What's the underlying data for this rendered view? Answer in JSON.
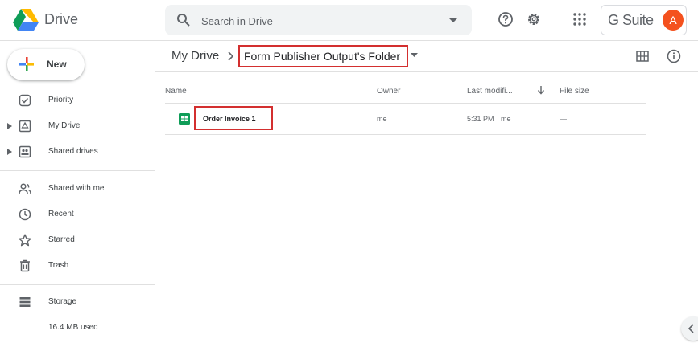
{
  "header": {
    "app_name": "Drive",
    "search_placeholder": "Search in Drive",
    "gsuite_label": "G Suite",
    "avatar_initial": "A",
    "colors": {
      "avatar": "#f4511e",
      "search_bg": "#f1f3f4"
    }
  },
  "sidebar": {
    "new_label": "New",
    "items": [
      {
        "label": "Priority",
        "icon": "priority-icon"
      },
      {
        "label": "My Drive",
        "icon": "my-drive-icon"
      },
      {
        "label": "Shared drives",
        "icon": "shared-drives-icon"
      },
      {
        "label": "Shared with me",
        "icon": "shared-with-me-icon"
      },
      {
        "label": "Recent",
        "icon": "clock-icon"
      },
      {
        "label": "Starred",
        "icon": "star-icon"
      },
      {
        "label": "Trash",
        "icon": "trash-icon"
      },
      {
        "label": "Storage",
        "icon": "storage-icon"
      }
    ],
    "storage_used": "16.4 MB used"
  },
  "breadcrumb": {
    "root": "My Drive",
    "current": "Form Publisher Output's Folder"
  },
  "table": {
    "columns": [
      "Name",
      "Owner",
      "Last modifi...",
      "File size"
    ],
    "rows": [
      {
        "name": "Order Invoice 1",
        "owner": "me",
        "modified_time": "5:31 PM",
        "modified_by": "me",
        "size": "—"
      }
    ]
  },
  "highlight_color": "#d32f2f"
}
